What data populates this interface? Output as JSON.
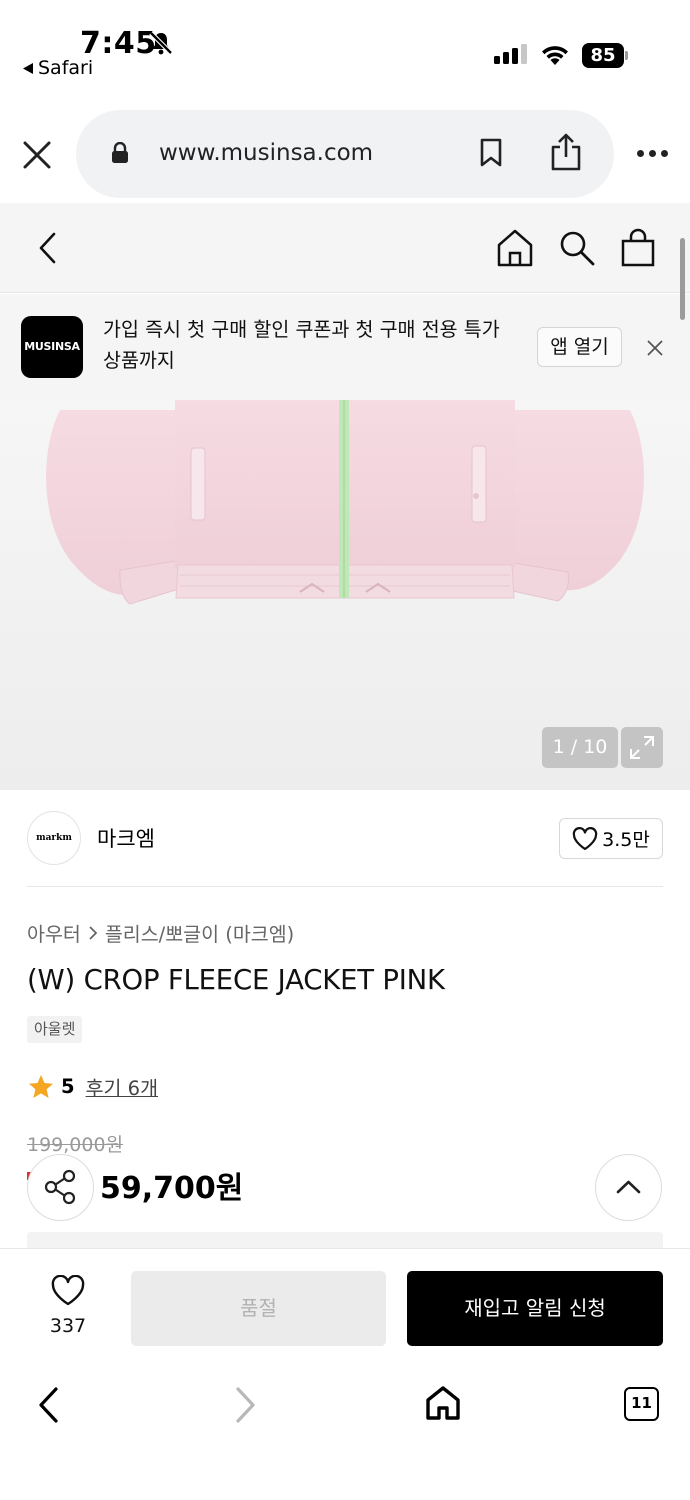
{
  "status_bar": {
    "time": "7:45",
    "back_app": "Safari",
    "battery": "85"
  },
  "browser": {
    "url": "www.musinsa.com"
  },
  "promo": {
    "logo_text": "MUSINSA",
    "message": "가입 즉시 첫 구매 할인 쿠폰과 첫 구매 전용 특가 상품까지",
    "open_app_label": "앱 열기"
  },
  "gallery": {
    "counter": "1 / 10"
  },
  "brand": {
    "logo_text": "markm",
    "name": "마크엠",
    "likes": "3.5만"
  },
  "product": {
    "category": "아우터",
    "subcategory": "플리스/뽀글이 (마크엠)",
    "title": "(W) CROP FLEECE JACKET PINK",
    "tag": "아울렛",
    "rating": "5",
    "reviews": "후기 6개",
    "original_price": "199,000원",
    "sale_price": "59,700원"
  },
  "actions": {
    "wish_count": "337",
    "sold_out_label": "품절",
    "restock_label": "재입고 알림 신청"
  },
  "safari_toolbar": {
    "tab_count": "11"
  },
  "colors": {
    "accent": "#000000",
    "star": "#f5a623",
    "sale_red": "#e42f2f",
    "jacket_pink": "#f3d5dc",
    "zipper_green": "#b8e6b0"
  }
}
